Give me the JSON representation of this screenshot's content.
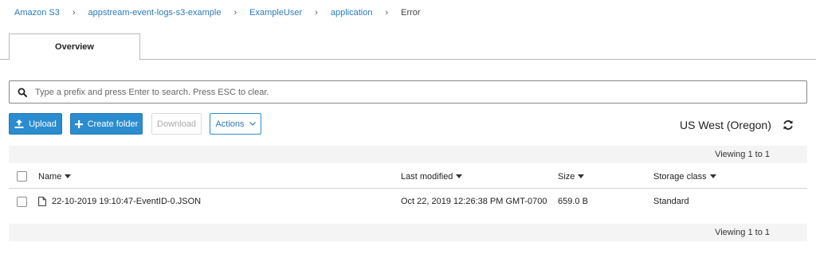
{
  "breadcrumb": {
    "items": [
      "Amazon S3",
      "appstream-event-logs-s3-example",
      "ExampleUser",
      "application"
    ],
    "current": "Error",
    "separator": "›"
  },
  "tabs": [
    {
      "label": "Overview",
      "active": true
    }
  ],
  "search": {
    "placeholder": "Type a prefix and press Enter to search. Press ESC to clear.",
    "value": ""
  },
  "toolbar": {
    "upload_label": "Upload",
    "create_folder_label": "Create folder",
    "download_label": "Download",
    "actions_label": "Actions"
  },
  "region": "US West (Oregon)",
  "viewing": {
    "top": "Viewing 1 to 1",
    "bottom": "Viewing 1 to 1"
  },
  "table": {
    "columns": {
      "name": "Name",
      "last_modified": "Last modified",
      "size": "Size",
      "storage_class": "Storage class"
    },
    "rows": [
      {
        "name": "22-10-2019 19:10:47-EventID-0.JSON",
        "last_modified": "Oct 22, 2019 12:26:38 PM GMT-0700",
        "size": "659.0 B",
        "storage_class": "Standard"
      }
    ]
  },
  "colors": {
    "link": "#2b7bb9",
    "primary": "#2b8ccf",
    "border": "#b9b9b9"
  },
  "icons": [
    "search-icon",
    "upload-icon",
    "plus-icon",
    "chevron-down-icon",
    "refresh-icon",
    "file-icon"
  ]
}
